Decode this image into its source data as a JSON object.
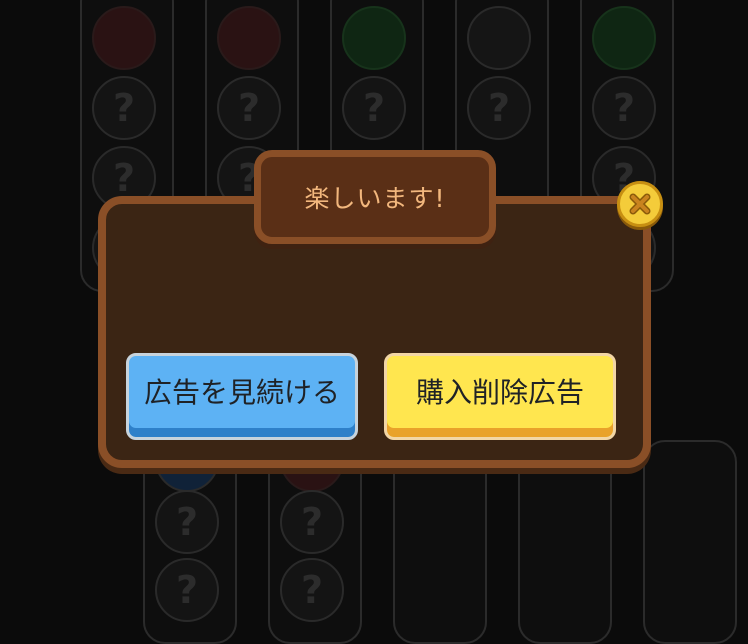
{
  "background": {
    "placeholder_glyph": "?"
  },
  "dialog": {
    "title": "楽しいます!",
    "close_icon": "close-x-icon",
    "buttons": {
      "watch_ads": "広告を見続ける",
      "remove_ads": "購入削除広告"
    }
  },
  "colors": {
    "panel": "#3b2514",
    "panel_border": "#8a4f27",
    "title_text": "#f2b77d",
    "close_button": "#f4cc3a",
    "watch_button": "#5db2f4",
    "remove_button": "#ffe64f"
  }
}
